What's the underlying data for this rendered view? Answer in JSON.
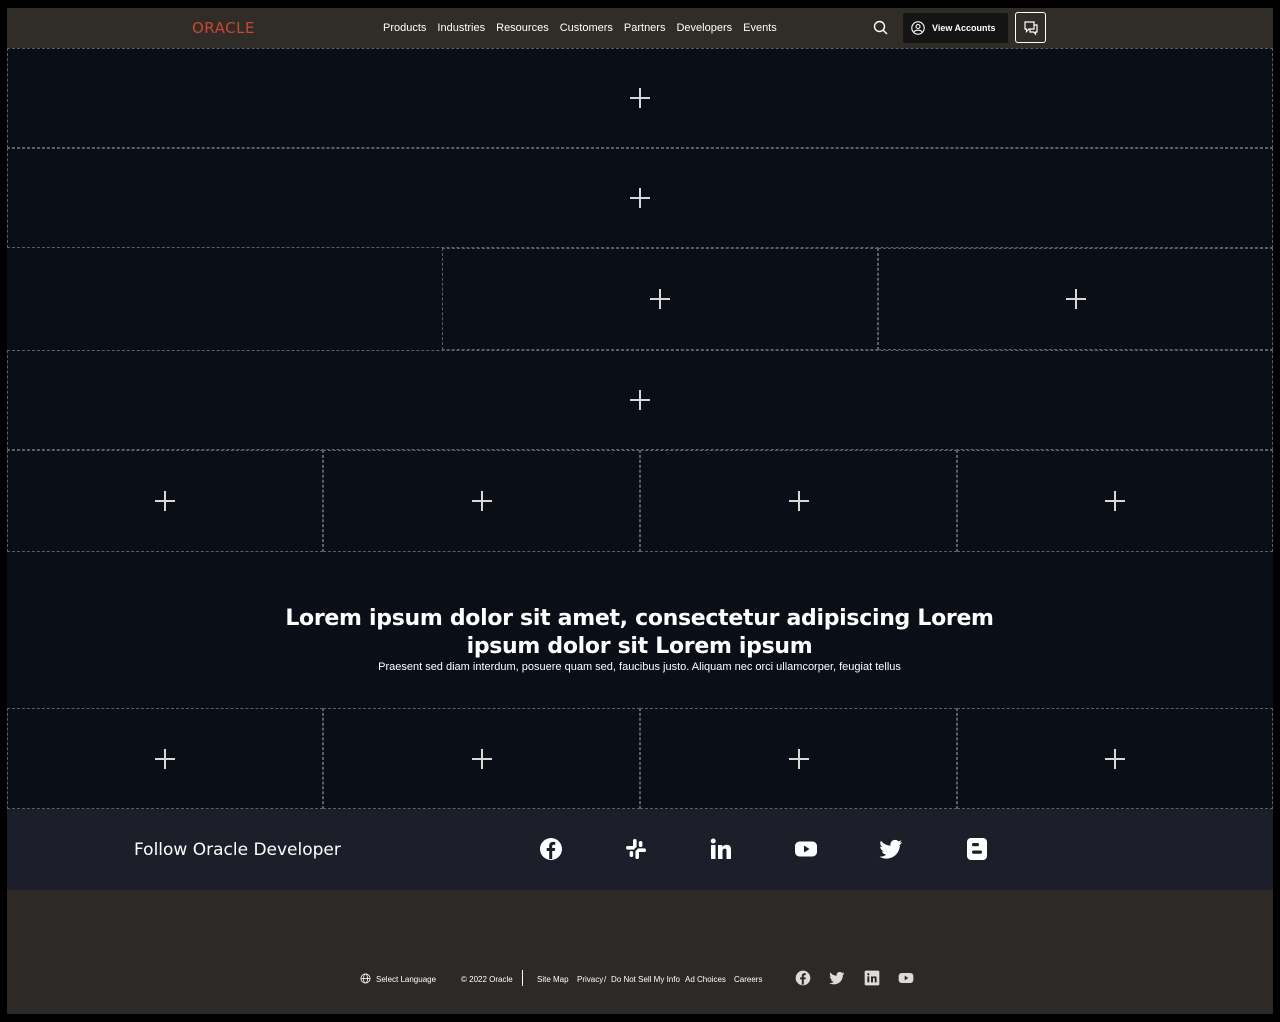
{
  "header": {
    "logo_text": "ORACLE",
    "logo_color": "#c74634",
    "nav": [
      "Products",
      "Industries",
      "Resources",
      "Customers",
      "Partners",
      "Developers",
      "Events"
    ],
    "account_label": "View Accounts"
  },
  "placeholder_rows": [
    {
      "count": 1
    },
    {
      "count": 1
    },
    {
      "count": 2
    },
    {
      "count": 1
    },
    {
      "count": 4
    }
  ],
  "hero": {
    "headline": "Lorem ipsum dolor sit amet, consectetur adipiscing Lorem ipsum dolor sit Lorem ipsum",
    "subtext": "Praesent sed diam interdum, posuere quam sed, faucibus justo. Aliquam nec orci ullamcorper, feugiat tellus"
  },
  "follow": {
    "label": "Follow Oracle Developer",
    "networks": [
      "facebook-icon",
      "slack-icon",
      "linkedin-icon",
      "youtube-icon",
      "twitter-icon",
      "blogger-icon"
    ]
  },
  "footer": {
    "language": "Select Language",
    "copyright": "© 2022 Oracle",
    "links": [
      "Site Map",
      "Privacy",
      "/",
      "Do Not Sell My Info",
      "Ad Choices",
      "Careers"
    ],
    "social": [
      "facebook-icon",
      "twitter-icon",
      "linkedin-icon",
      "youtube-icon"
    ]
  },
  "colors": {
    "page_bg": "#0a0e16",
    "header_bg": "#302d28",
    "follow_bg": "#1c1f2a",
    "footer_bg": "#2d2926"
  }
}
